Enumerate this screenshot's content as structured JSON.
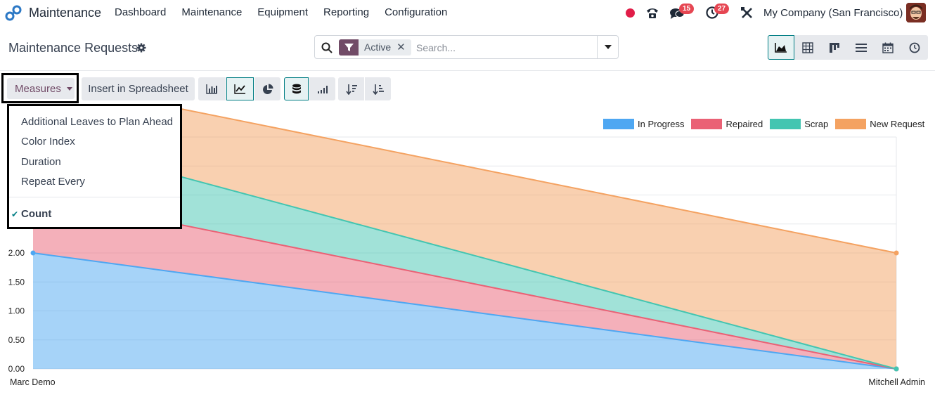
{
  "navbar": {
    "app_name": "Maintenance",
    "menu": [
      "Dashboard",
      "Maintenance",
      "Equipment",
      "Reporting",
      "Configuration"
    ],
    "messages_badge": "15",
    "activities_badge": "27",
    "company": "My Company (San Francisco)"
  },
  "control_panel": {
    "title": "Maintenance Requests",
    "facet_label": "Active",
    "facet_remove": "✕",
    "search_placeholder": "Search..."
  },
  "toolbar": {
    "measures_label": "Measures",
    "spreadsheet_label": "Insert in Spreadsheet"
  },
  "measures_menu": {
    "items": [
      "Additional Leaves to Plan Ahead",
      "Color Index",
      "Duration",
      "Repeat Every"
    ],
    "selected": "Count"
  },
  "colors": {
    "accent": "#714b67",
    "teal": "#017e84",
    "in_progress": "#4ea7f2",
    "repaired": "#ea6175",
    "scrap": "#43c5b1",
    "new_request": "#f4a261"
  },
  "chart_data": {
    "type": "area",
    "stacked": true,
    "categories": [
      "Marc Demo",
      "Mitchell Admin"
    ],
    "series": [
      {
        "name": "In Progress",
        "values": [
          2,
          0
        ],
        "color": "#4ea7f2"
      },
      {
        "name": "Repaired",
        "values": [
          1,
          0
        ],
        "color": "#ea6175"
      },
      {
        "name": "Scrap",
        "values": [
          1,
          0
        ],
        "color": "#43c5b1"
      },
      {
        "name": "New Request",
        "values": [
          1,
          2
        ],
        "color": "#f4a261"
      }
    ],
    "y_ticks": [
      "0.00",
      "0.50",
      "1.00",
      "1.50",
      "2.00"
    ],
    "ylim": [
      0,
      4
    ],
    "grid": true,
    "legend_position": "top-right"
  }
}
